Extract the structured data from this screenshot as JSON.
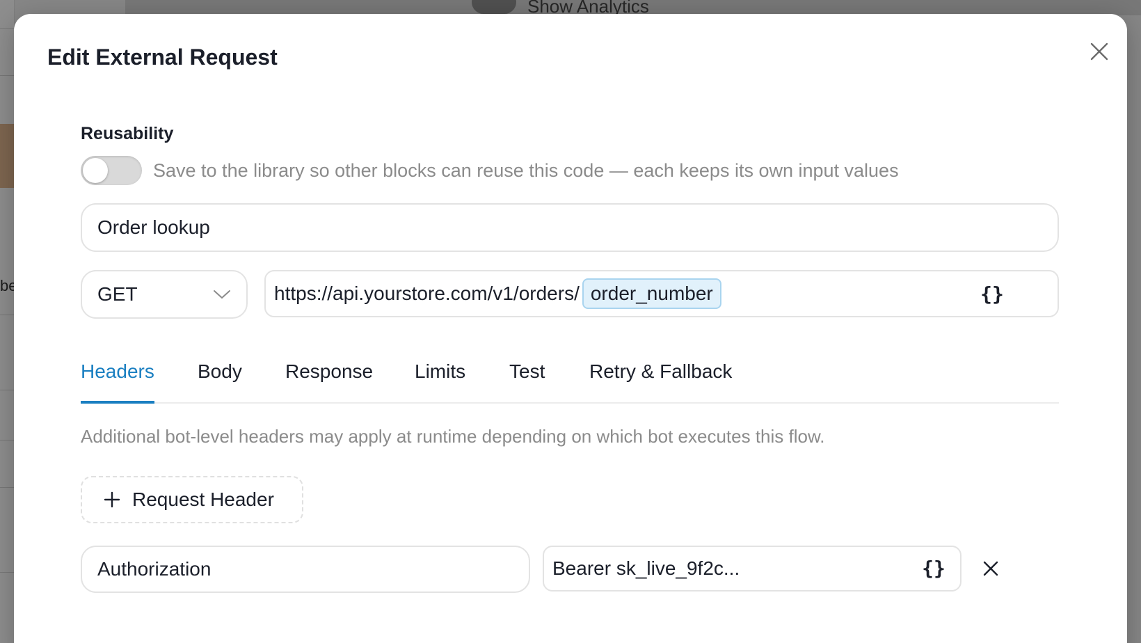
{
  "background": {
    "toolbar_text": "Show Analytics",
    "side_fragment": "be"
  },
  "modal": {
    "title": "Edit External Request",
    "close_icon": "close-icon",
    "reusability": {
      "label": "Reusability",
      "toggle_on": false,
      "description": "Save to the library so other blocks can reuse this code — each keeps its own input values"
    },
    "name_value": "Order lookup",
    "method": {
      "selected": "GET",
      "icon": "chevron-down-icon"
    },
    "url": {
      "text": "https://api.yourstore.com/v1/orders/",
      "variable": "order_number",
      "variable_button_icon": "braces-icon",
      "variable_button_label": "{}"
    },
    "tabs": [
      {
        "label": "Headers",
        "active": true
      },
      {
        "label": "Body",
        "active": false
      },
      {
        "label": "Response",
        "active": false
      },
      {
        "label": "Limits",
        "active": false
      },
      {
        "label": "Test",
        "active": false
      },
      {
        "label": "Retry & Fallback",
        "active": false
      }
    ],
    "headers_panel": {
      "note": "Additional bot-level headers may apply at runtime depending on which bot executes this flow.",
      "add_button_label": "Request Header",
      "rows": [
        {
          "key": "Authorization",
          "value": "Bearer sk_live_9f2c..."
        }
      ]
    }
  },
  "colors": {
    "accent": "#1a7fc1",
    "chip_bg": "#e1f1fb",
    "chip_border": "#a9d4ef",
    "muted_text": "#8b8b8b",
    "text": "#1b1f2a"
  }
}
